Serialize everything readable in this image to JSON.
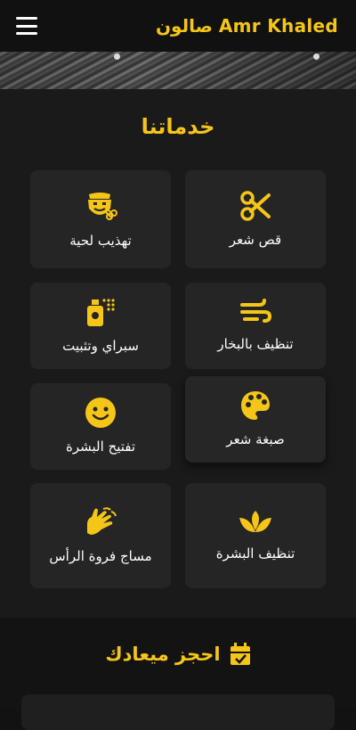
{
  "header": {
    "title": "صالون Amr Khaled",
    "menu_icon": "hamburger-menu-icon",
    "accent_color": "#f5c518"
  },
  "services": {
    "title": "خدماتنا",
    "items": [
      {
        "label": "قص شعر",
        "icon": "scissors-icon"
      },
      {
        "label": "تهذيب لحية",
        "icon": "beard-trim-icon"
      },
      {
        "label": "تنظيف بالبخار",
        "icon": "steam-icon"
      },
      {
        "label": "سبراي وتثبيت",
        "icon": "spray-bottle-icon"
      },
      {
        "label": "صبغة شعر",
        "icon": "palette-icon"
      },
      {
        "label": "تفتيح البشرة",
        "icon": "smile-icon"
      },
      {
        "label": "تنظيف البشرة",
        "icon": "spa-lotus-icon"
      },
      {
        "label": "مساج فروة الرأس",
        "icon": "massage-hands-icon"
      }
    ]
  },
  "booking": {
    "title": "احجز ميعادك",
    "icon": "calendar-check-icon"
  }
}
